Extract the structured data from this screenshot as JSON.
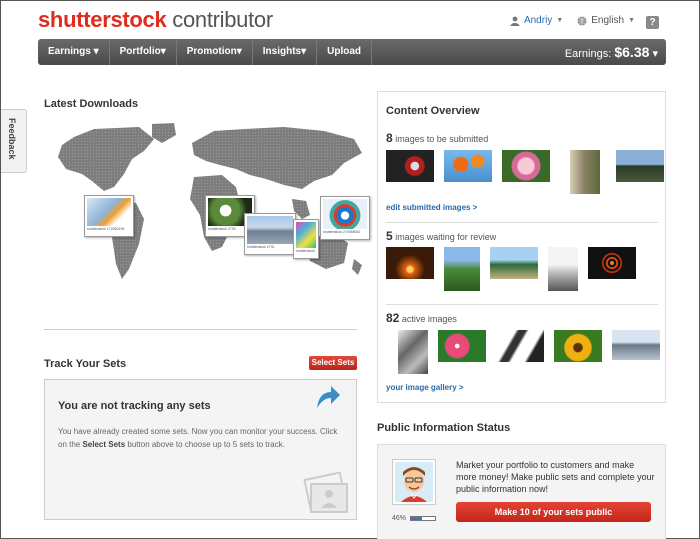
{
  "header": {
    "brand": "shutterstock",
    "brand_sub": " contributor",
    "user": "Andriy",
    "language": "English",
    "help": "?"
  },
  "nav": {
    "items": [
      "Earnings",
      "Portfolio",
      "Promotion",
      "Insights",
      "Upload"
    ],
    "earnings_label": "Earnings:",
    "earnings_value": "$6.38"
  },
  "feedback": {
    "label": "Feedback"
  },
  "downloads": {
    "title": "Latest Downloads",
    "captions": [
      "shutterstock 172060199",
      "shutterstock 2730",
      "shutterstock 2731",
      "shutterstock 27306",
      "shutterstock 274068041"
    ]
  },
  "track": {
    "title": "Track Your Sets",
    "select_button": "Select Sets",
    "heading": "You are not tracking any sets",
    "text_1": "You have already created some sets. Now you can monitor your success. Click on the ",
    "text_bold": "Select Sets",
    "text_2": " button above to choose up to 5 sets to track."
  },
  "overview": {
    "title": "Content Overview",
    "submitted": {
      "count": "8",
      "label": " images to be submitted",
      "link": "edit submitted images >"
    },
    "review": {
      "count": "5",
      "label": " images waiting for review"
    },
    "active": {
      "count": "82",
      "label": " active images",
      "link": "your image gallery >"
    }
  },
  "public": {
    "title": "Public Information Status",
    "text": "Market your portfolio to customers and make more money! Make public sets and complete your public information now!",
    "percent": "46%",
    "progress": 0.46,
    "button": "Make 10 of your sets public"
  }
}
